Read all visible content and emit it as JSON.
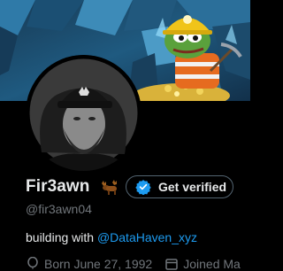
{
  "profile": {
    "name": "Fir3awn",
    "handle": "@fir3awn04",
    "verify_button_label": "Get verified",
    "bio_prefix": "building with",
    "bio_mention": "@DataHaven_xyz",
    "born": "Born June 27, 1992",
    "joined": "Joined Ma"
  },
  "colors": {
    "background": "#000000",
    "text": "#e7e9ea",
    "muted": "#71767b",
    "link": "#1d9bf0",
    "verified_badge": "#1d9bf0"
  },
  "icons": {
    "name_emoji": "moose-emoji",
    "verify": "verified-check-icon",
    "born": "balloon-icon",
    "joined": "calendar-icon"
  }
}
